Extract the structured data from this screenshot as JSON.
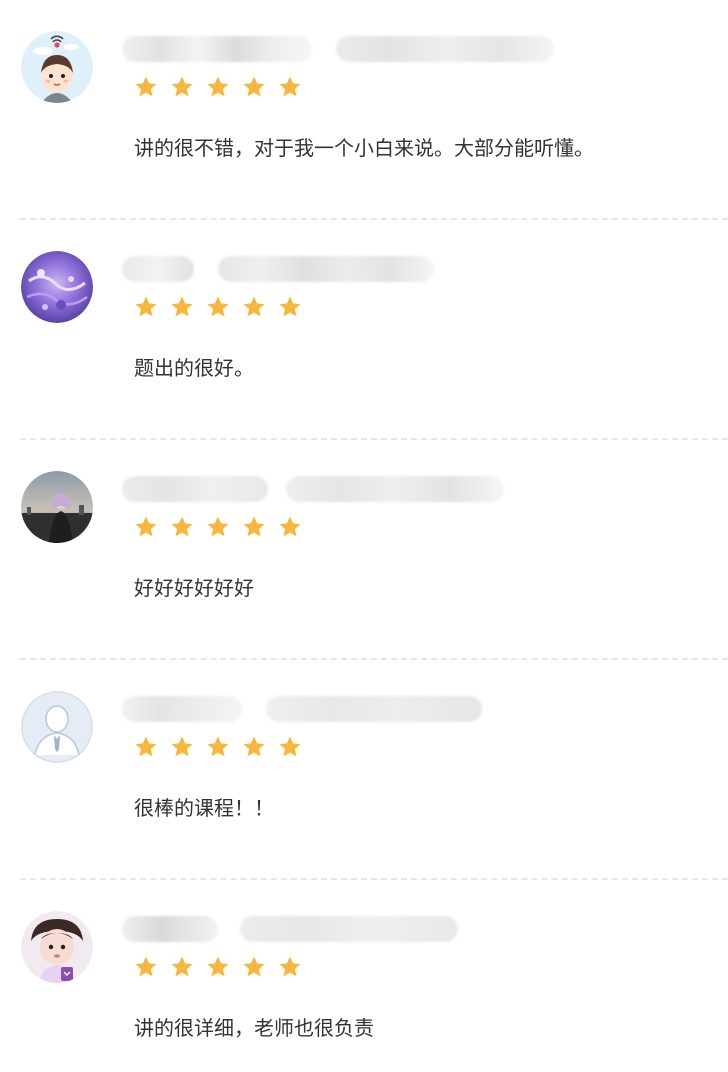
{
  "reviews": [
    {
      "avatar": "cartoon-boy-avatar",
      "user": "",
      "date": "",
      "rating": 5,
      "comment": "讲的很不错，对于我一个小白来说。大部分能听懂。"
    },
    {
      "avatar": "purple-painting-avatar",
      "user": "",
      "date": "",
      "rating": 5,
      "comment": "题出的很好。"
    },
    {
      "avatar": "photo-person-avatar",
      "user": "",
      "date": "",
      "rating": 5,
      "comment": "好好好好好好"
    },
    {
      "avatar": "default-user-avatar",
      "user": "",
      "date": "",
      "rating": 5,
      "comment": "很棒的课程！！"
    },
    {
      "avatar": "child-photo-avatar",
      "user": "",
      "date": "",
      "rating": 5,
      "comment": "讲的很详细，老师也很负责"
    }
  ],
  "colors": {
    "star": "#f6b73c",
    "divider": "#e6e6e6",
    "text": "#333333",
    "blur": "#e8e8e8"
  }
}
